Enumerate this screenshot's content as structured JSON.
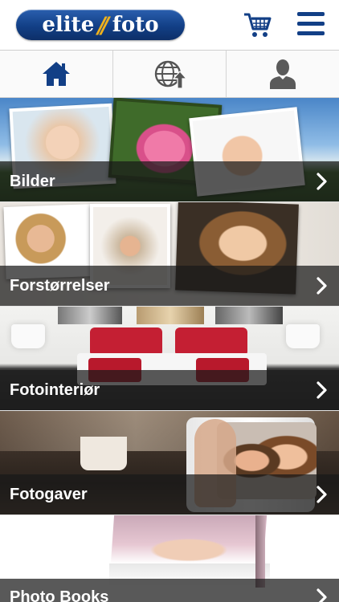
{
  "header": {
    "logo_text_left": "elite",
    "logo_text_right": "foto",
    "cart_icon": "shopping-cart-icon",
    "menu_icon": "hamburger-menu-icon"
  },
  "tabs": [
    {
      "icon": "home-icon"
    },
    {
      "icon": "globe-upload-icon"
    },
    {
      "icon": "user-icon"
    }
  ],
  "categories": [
    {
      "label": "Bilder"
    },
    {
      "label": "Forstørrelser"
    },
    {
      "label": "Fotointeriør"
    },
    {
      "label": "Fotogaver"
    },
    {
      "label": "Photo Books"
    }
  ],
  "colors": {
    "brand_blue": "#123f86",
    "brand_accent": "#f1b21c",
    "overlay": "#191919"
  }
}
